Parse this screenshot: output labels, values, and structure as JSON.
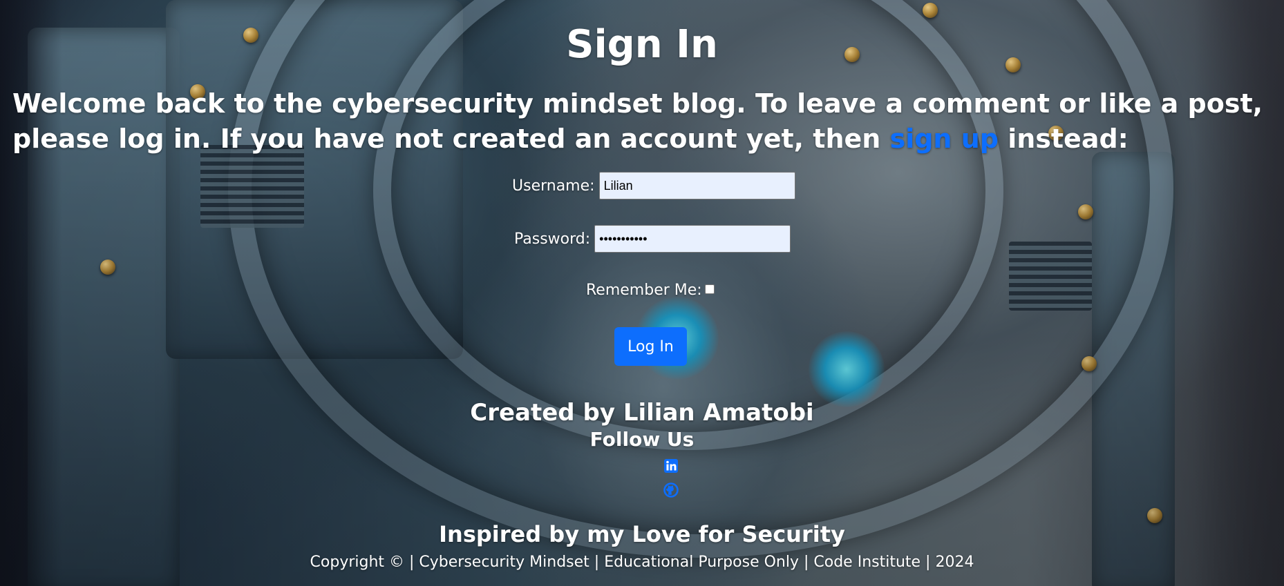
{
  "page": {
    "title": "Sign In",
    "intro_text": "Welcome back to the cybersecurity mindset blog. To leave a comment or like a post, please log in. If you have not created an account yet, then ",
    "signup_link_text": "sign up",
    "intro_suffix": " instead:"
  },
  "form": {
    "username_label": "Username:",
    "username_value": "Lilian",
    "password_label": "Password:",
    "password_value": "•••••••••••",
    "remember_label": "Remember Me:",
    "remember_checked": false,
    "login_button": "Log In"
  },
  "footer": {
    "created_by": "Created by Lilian Amatobi",
    "follow_us": "Follow Us",
    "social": [
      "linkedin-icon",
      "github-icon"
    ],
    "inspired": "Inspired by my Love for Security",
    "copyright": "Copyright © | Cybersecurity Mindset | Educational Purpose Only | Code Institute | 2024"
  },
  "colors": {
    "link": "#0d6efd",
    "button": "#0d6efd",
    "text": "#ffffff",
    "input_bg": "#e8f0fe"
  }
}
